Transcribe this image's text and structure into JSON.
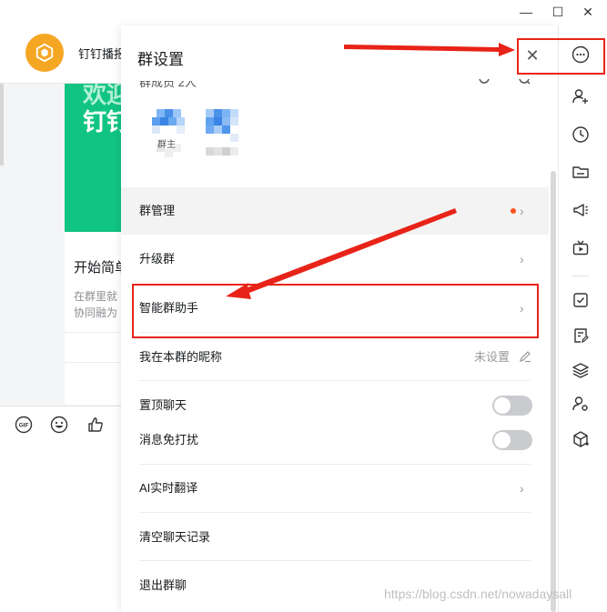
{
  "window": {
    "minimize": "—",
    "maximize": "☐",
    "close": "✕"
  },
  "chat": {
    "title": "钉钉播报",
    "banner_line1": "欢迎",
    "banner_line2": "钉钉",
    "card_title": "开始简单",
    "card_line1": "在群里就",
    "card_line2": "协同融为"
  },
  "toolbar": {
    "gif_label": "GIF"
  },
  "panel": {
    "title": "群设置",
    "close_icon": "✕",
    "members_label": "群成员 2人",
    "owner_tag": "群主",
    "rows": [
      {
        "label": "群管理"
      },
      {
        "label": "升级群"
      },
      {
        "label": "智能群助手"
      },
      {
        "label": "我在本群的昵称",
        "value": "未设置"
      },
      {
        "label": "置顶聊天"
      },
      {
        "label": "消息免打扰"
      },
      {
        "label": "AI实时翻译"
      },
      {
        "label": "清空聊天记录"
      },
      {
        "label": "退出群聊"
      }
    ],
    "chevron": "›"
  },
  "colors": {
    "accent_green": "#11c484",
    "highlight_red": "#e82318",
    "dot_red": "#ff5219",
    "avatar_orange": "#f5a623"
  },
  "watermark": "https://blog.csdn.net/nowadaysall"
}
